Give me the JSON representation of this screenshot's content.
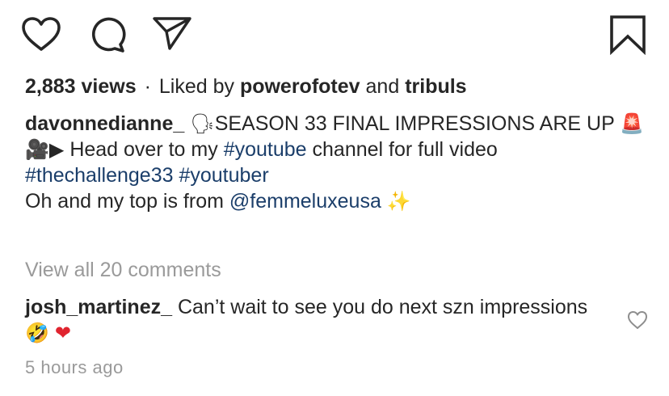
{
  "post": {
    "stats": {
      "views": "2,883 views",
      "separator": "·",
      "liked_prefix": "Liked by",
      "liker_1": "powerofotev",
      "and": "and",
      "liker_2": "tribuls"
    },
    "caption": {
      "username": "davonnedianne_",
      "speaking_emoji": "🗣",
      "text_1": "SEASON 33 FINAL IMPRESSIONS ARE UP",
      "siren_emoji": "🚨",
      "camera_emoji": "🎥",
      "play_emoji": "▶",
      "text_2": "Head over to my",
      "hashtag_youtube": "#youtube",
      "text_3": "channel for full video",
      "hashtag_challenge": "#thechallenge33",
      "hashtag_youtuber": "#youtuber",
      "text_4": "Oh and my top is from",
      "mention": "@femmeluxeusa",
      "sparkle_emoji": "✨"
    },
    "view_all_comments": "View all 20 comments",
    "comment": {
      "username": "josh_martinez_",
      "text": "Can’t wait to see you do next szn impressions",
      "laugh_emoji": "🤣",
      "heart_emoji": "❤"
    },
    "timestamp": "5 hours ago"
  },
  "icons": {
    "like": "heart-outline-icon",
    "comment": "comment-bubble-icon",
    "share": "paper-plane-icon",
    "save": "bookmark-icon",
    "comment_like": "small-heart-outline-icon"
  },
  "colors": {
    "text": "#262626",
    "link": "#1b3e6a",
    "muted": "#9a9a9a",
    "heart_red": "#e0242f"
  }
}
